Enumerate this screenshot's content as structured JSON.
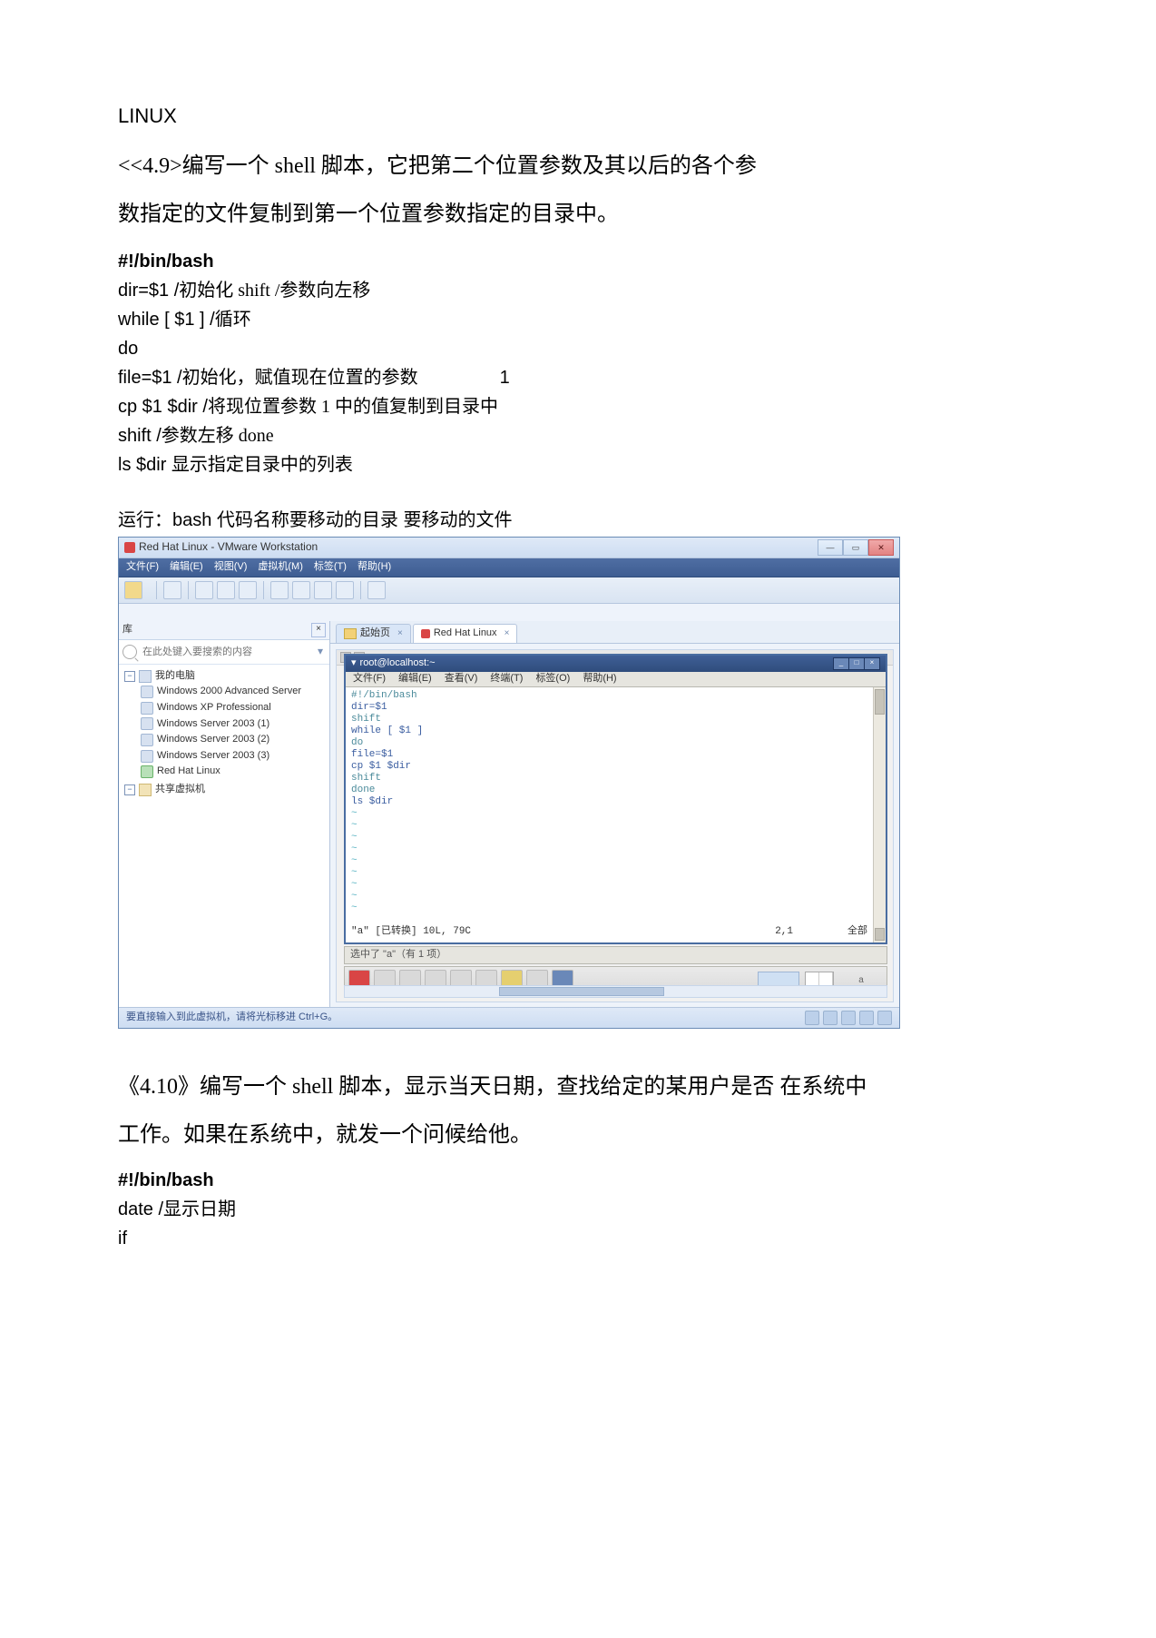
{
  "header": {
    "linux_label": "LINUX"
  },
  "q49": {
    "line1": "<<4.9>编写一个 shell 脚本，它把第二个位置参数及其以后的各个参",
    "line2": "数指定的文件复制到第一个位置参数指定的目录中。"
  },
  "code1": {
    "shebang": "#!/bin/bash",
    "l1a": "dir=$1 /",
    "l1b": "初始化  shift /",
    "l1c": "参数向左移",
    "l2a": "while [     $1 ] /",
    "l2b": "循环",
    "l3": "do",
    "l4a": "file=$1 /",
    "l4b": "初始化，赋值现在位置的参数",
    "l4c": "1",
    "l5a": "cp $1 $dir /",
    "l5b": "将现位置参数 1 中的值复制到目录中",
    "l6a": "shift /",
    "l6b": "参数左移  done",
    "l7a": "ls $dir ",
    "l7b": "显示指定目录中的列表"
  },
  "run": {
    "prefix": "运行：",
    "rest": "bash 代码名称要移动的目录  要移动的文件"
  },
  "screenshot": {
    "window_title": "Red Hat Linux - VMware Workstation",
    "menus": [
      "文件(F)",
      "编辑(E)",
      "视图(V)",
      "虚拟机(M)",
      "标签(T)",
      "帮助(H)"
    ],
    "left_pane": {
      "title": "库",
      "search_placeholder": "在此处键入要搜索的内容",
      "root": "我的电脑",
      "items": [
        "Windows 2000 Advanced Server",
        "Windows XP Professional",
        "Windows Server 2003 (1)",
        "Windows Server 2003 (2)",
        "Windows Server 2003 (3)",
        "Red Hat Linux"
      ],
      "shared": "共享虚拟机"
    },
    "tabs": {
      "home": "起始页",
      "rhl": "Red Hat Linux"
    },
    "terminal": {
      "title": "root@localhost:~",
      "menus": [
        "文件(F)",
        "编辑(E)",
        "查看(V)",
        "终端(T)",
        "标签(O)",
        "帮助(H)"
      ],
      "lines": [
        "#!/bin/bash",
        "dir=$1",
        "shift",
        "while [ $1 ]",
        "do",
        "file=$1",
        "cp $1 $dir",
        "shift",
        "done",
        "ls $dir"
      ],
      "status_left": "\"a\" [已转换] 10L, 79C",
      "status_right_pos": "2,1",
      "status_right_all": "全部"
    },
    "find_bar": "选中了 \"a\"（有 1 项）",
    "statusbar": "要直接输入到此虚拟机，请将光标移进 Ctrl+G。"
  },
  "q410": {
    "line1": "《4.10》编写一个 shell 脚本，显示当天日期，查找给定的某用户是否  在系统中",
    "line2": "工作。如果在系统中，就发一个问候给他。"
  },
  "code2": {
    "shebang": "#!/bin/bash",
    "l1a": "date /",
    "l1b": "显示日期",
    "l2": "if"
  }
}
